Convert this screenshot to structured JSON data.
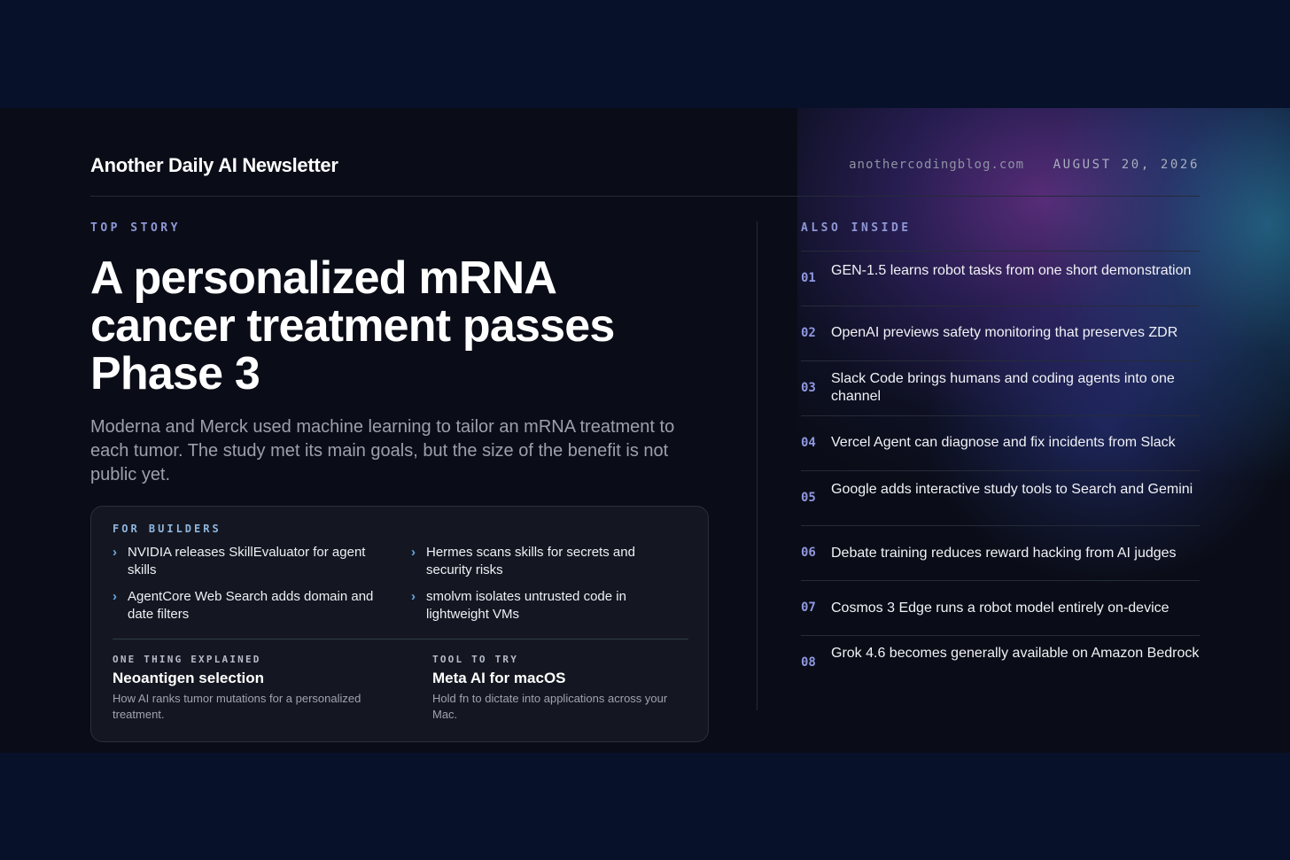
{
  "header": {
    "brand": "Another Daily AI Newsletter",
    "site": "anothercodingblog.com",
    "date": "AUGUST 20, 2026"
  },
  "top_story": {
    "kicker": "TOP STORY",
    "headline": "A personalized mRNA cancer treatment passes Phase 3",
    "dek": "Moderna and Merck used machine learning to tailor an mRNA treatment to each tumor. The study met its main goals, but the size of the benefit is not public yet."
  },
  "builders": {
    "kicker": "FOR BUILDERS",
    "items": [
      "NVIDIA releases SkillEvaluator for agent skills",
      "Hermes scans skills for secrets and security risks",
      "AgentCore Web Search adds domain and date filters",
      "smolvm isolates untrusted code in lightweight VMs"
    ]
  },
  "explained": {
    "label": "ONE THING EXPLAINED",
    "title": "Neoantigen selection",
    "desc": "How AI ranks tumor mutations for a personalized treatment."
  },
  "tool": {
    "label": "TOOL TO TRY",
    "title": "Meta AI for macOS",
    "desc": "Hold fn to dictate into applications across your Mac."
  },
  "also_inside": {
    "kicker": "ALSO INSIDE",
    "items": [
      {
        "num": "01",
        "text": "GEN-1.5 learns robot tasks from one short demonstration"
      },
      {
        "num": "02",
        "text": "OpenAI previews safety monitoring that preserves ZDR"
      },
      {
        "num": "03",
        "text": "Slack Code brings humans and coding agents into one channel"
      },
      {
        "num": "04",
        "text": "Vercel Agent can diagnose and fix incidents from Slack"
      },
      {
        "num": "05",
        "text": "Google adds interactive study tools to Search and Gemini"
      },
      {
        "num": "06",
        "text": "Debate training reduces reward hacking from AI judges"
      },
      {
        "num": "07",
        "text": "Cosmos 3 Edge runs a robot model entirely on-device"
      },
      {
        "num": "08",
        "text": "Grok 4.6 becomes generally available on Amazon Bedrock"
      }
    ]
  }
}
